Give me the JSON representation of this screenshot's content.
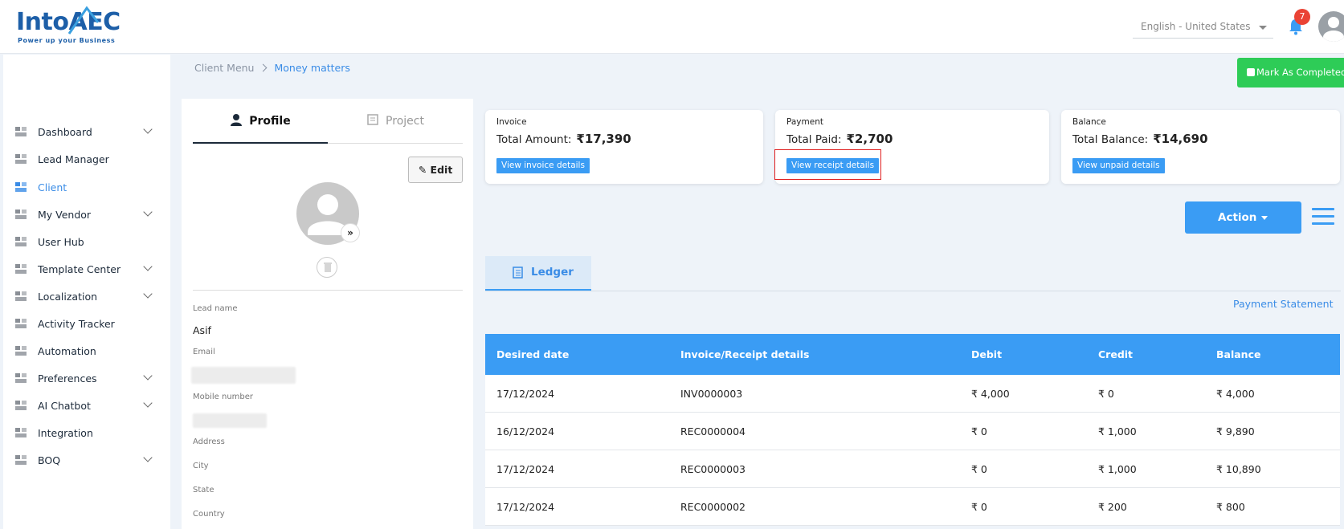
{
  "header": {
    "logo_text": "IntoAEC",
    "logo_tagline": "Power up your Business",
    "language": "English - United States",
    "notification_count": "7",
    "edit_ghost": "edit"
  },
  "sidebar": {
    "items": [
      {
        "label": "Dashboard",
        "icon": "dashboard-icon",
        "has_chevron": true
      },
      {
        "label": "Lead Manager",
        "icon": "lead-icon",
        "has_chevron": false
      },
      {
        "label": "Client",
        "icon": "client-icon",
        "has_chevron": false,
        "active": true
      },
      {
        "label": "My Vendor",
        "icon": "vendor-icon",
        "has_chevron": true
      },
      {
        "label": "User Hub",
        "icon": "user-icon",
        "has_chevron": false
      },
      {
        "label": "Template Center",
        "icon": "template-icon",
        "has_chevron": true
      },
      {
        "label": "Localization",
        "icon": "localization-icon",
        "has_chevron": true
      },
      {
        "label": "Activity Tracker",
        "icon": "activity-icon",
        "has_chevron": false
      },
      {
        "label": "Automation",
        "icon": "automation-icon",
        "has_chevron": false
      },
      {
        "label": "Preferences",
        "icon": "preferences-icon",
        "has_chevron": true
      },
      {
        "label": "AI Chatbot",
        "icon": "chatbot-icon",
        "has_chevron": true
      },
      {
        "label": "Integration",
        "icon": "integration-icon",
        "has_chevron": false
      },
      {
        "label": "BOQ",
        "icon": "boq-icon",
        "has_chevron": true
      }
    ]
  },
  "breadcrumb": {
    "parent": "Client Menu",
    "current": "Money matters"
  },
  "mark_completed_label": "Mark As Completed",
  "profile": {
    "tab_profile": "Profile",
    "tab_project": "Project",
    "edit_label": "Edit",
    "fields": {
      "lead_name_label": "Lead name",
      "lead_name_value": "Asif",
      "email_label": "Email",
      "mobile_label": "Mobile number",
      "address_label": "Address",
      "city_label": "City",
      "state_label": "State",
      "country_label": "Country"
    }
  },
  "cards": {
    "invoice": {
      "heading": "Invoice",
      "amount_label": "Total Amount:",
      "amount": "₹17,390",
      "button": "View invoice details"
    },
    "payment": {
      "heading": "Payment",
      "amount_label": "Total Paid:",
      "amount": "₹2,700",
      "button": "View receipt details"
    },
    "balance": {
      "heading": "Balance",
      "amount_label": "Total Balance:",
      "amount": "₹14,690",
      "button": "View unpaid details"
    }
  },
  "action_label": "Action",
  "ledger_tab": "Ledger",
  "payment_statement": "Payment Statement",
  "table": {
    "headers": [
      "Desired date",
      "Invoice/Receipt details",
      "Debit",
      "Credit",
      "Balance"
    ],
    "rows": [
      [
        "17/12/2024",
        "INV0000003",
        "₹ 4,000",
        "₹ 0",
        "₹ 4,000"
      ],
      [
        "16/12/2024",
        "REC0000004",
        "₹ 0",
        "₹ 1,000",
        "₹ 9,890"
      ],
      [
        "17/12/2024",
        "REC0000003",
        "₹ 0",
        "₹ 1,000",
        "₹ 10,890"
      ],
      [
        "17/12/2024",
        "REC0000002",
        "₹ 0",
        "₹ 200",
        "₹ 800"
      ]
    ]
  },
  "colors": {
    "accent": "#3a9cf4",
    "success": "#2ecc57",
    "highlight": "#e02020",
    "badge": "#ea4335"
  }
}
